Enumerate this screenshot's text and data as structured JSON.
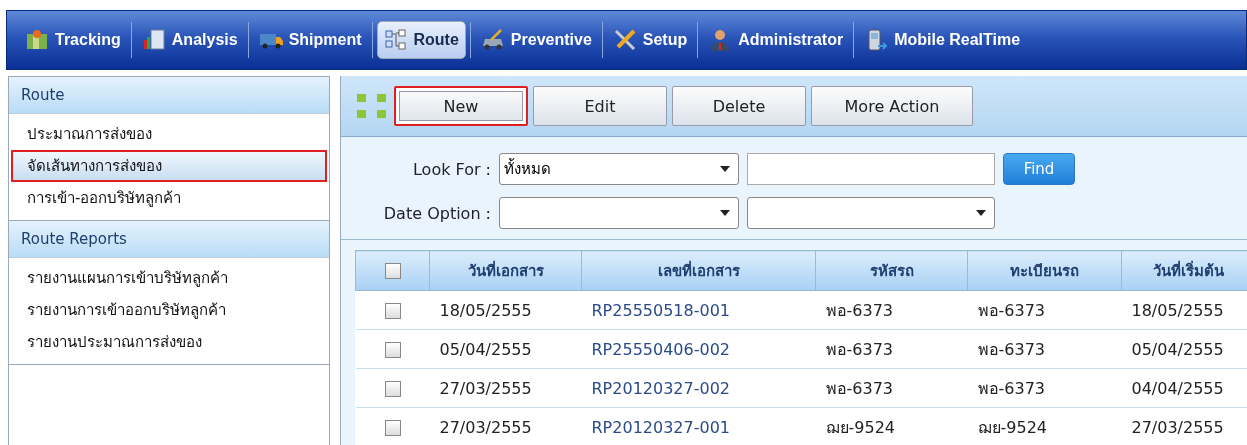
{
  "nav": [
    {
      "label": "Tracking",
      "selected": false
    },
    {
      "label": "Analysis",
      "selected": false
    },
    {
      "label": "Shipment",
      "selected": false
    },
    {
      "label": "Route",
      "selected": true
    },
    {
      "label": "Preventive",
      "selected": false
    },
    {
      "label": "Setup",
      "selected": false
    },
    {
      "label": "Administrator",
      "selected": false
    },
    {
      "label": "Mobile RealTime",
      "selected": false
    }
  ],
  "sidebar": [
    {
      "title": "Route",
      "items": [
        {
          "label": "ประมาณการส่งของ",
          "selected": false
        },
        {
          "label": "จัดเส้นทางการส่งของ",
          "selected": true
        },
        {
          "label": "การเข้า-ออกบริษัทลูกค้า",
          "selected": false
        }
      ]
    },
    {
      "title": "Route Reports",
      "items": [
        {
          "label": "รายงานแผนการเข้าบริษัทลูกค้า",
          "selected": false
        },
        {
          "label": "รายงานการเข้าออกบริษัทลูกค้า",
          "selected": false
        },
        {
          "label": "รายงานประมาณการส่งของ",
          "selected": false
        }
      ]
    }
  ],
  "toolbar": [
    {
      "label": "New",
      "highlighted": true
    },
    {
      "label": "Edit",
      "highlighted": false
    },
    {
      "label": "Delete",
      "highlighted": false
    },
    {
      "label": "More Action",
      "highlighted": false
    }
  ],
  "filter": {
    "look_for_label": "Look For :",
    "look_for_value": "ทั้งหมด",
    "find_button": "Find",
    "date_option_label": "Date Option :"
  },
  "table": {
    "header_checked": false,
    "columns": [
      "วันที่เอกสาร",
      "เลขที่เอกสาร",
      "รหัสรถ",
      "ทะเบียนรถ",
      "วันที่เริ่มต้น"
    ],
    "rows": [
      {
        "checked": false,
        "cells": [
          "18/05/2555",
          "RP25550518-001",
          "พอ-6373",
          "พอ-6373",
          "18/05/2555"
        ]
      },
      {
        "checked": false,
        "cells": [
          "05/04/2555",
          "RP25550406-002",
          "พอ-6373",
          "พอ-6373",
          "05/04/2555"
        ]
      },
      {
        "checked": false,
        "cells": [
          "27/03/2555",
          "RP20120327-002",
          "พอ-6373",
          "พอ-6373",
          "04/04/2555"
        ]
      },
      {
        "checked": false,
        "cells": [
          "27/03/2555",
          "RP20120327-001",
          "ฌย-9524",
          "ฌย-9524",
          "27/03/2555"
        ]
      }
    ]
  }
}
